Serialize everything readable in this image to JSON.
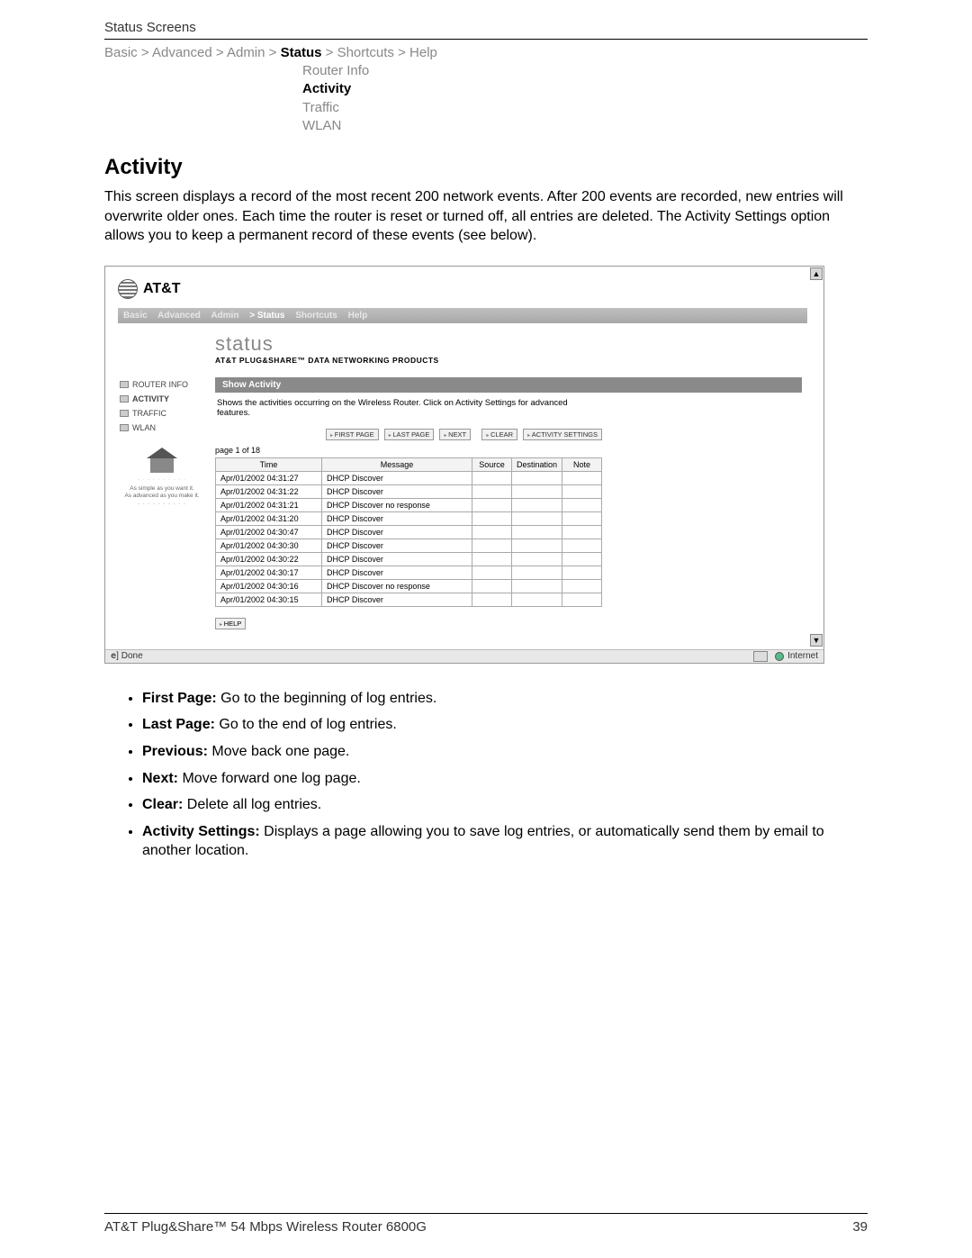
{
  "header": {
    "section": "Status Screens"
  },
  "breadcrumb": {
    "items": [
      "Basic",
      "Advanced",
      "Admin",
      "Status",
      "Shortcuts",
      "Help"
    ],
    "active": "Status"
  },
  "subnav": {
    "items": [
      "Router Info",
      "Activity",
      "Traffic",
      "WLAN"
    ],
    "active": "Activity"
  },
  "title": "Activity",
  "intro": "This screen displays a record of the most recent 200 network events. After 200 events are recorded, new entries will overwrite older ones. Each time the router is reset or turned off, all entries are deleted. The Activity Settings option allows you to keep a permanent record of these events (see below).",
  "screenshot": {
    "logo": "AT&T",
    "tabs": [
      "Basic",
      "Advanced",
      "Admin",
      "Status",
      "Shortcuts",
      "Help"
    ],
    "statusTitle": "status",
    "statusSub": "AT&T PLUG&SHARE™ DATA NETWORKING PRODUCTS",
    "sideItems": [
      "ROUTER INFO",
      "ACTIVITY",
      "TRAFFIC",
      "WLAN"
    ],
    "sideActive": "ACTIVITY",
    "tag1": "As simple as you want it.",
    "tag2": "As advanced as you make it.",
    "panelTitle": "Show Activity",
    "panelDesc": "Shows the activities occurring on the Wireless Router. Click on Activity Settings for advanced features.",
    "buttons": [
      "FIRST PAGE",
      "LAST PAGE",
      "NEXT",
      "CLEAR",
      "ACTIVITY SETTINGS"
    ],
    "pageInfo": "page 1 of 18",
    "cols": [
      "Time",
      "Message",
      "Source",
      "Destination",
      "Note"
    ],
    "rows": [
      {
        "t": "Apr/01/2002 04:31:27",
        "m": "DHCP Discover"
      },
      {
        "t": "Apr/01/2002 04:31:22",
        "m": "DHCP Discover"
      },
      {
        "t": "Apr/01/2002 04:31:21",
        "m": "DHCP Discover no response"
      },
      {
        "t": "Apr/01/2002 04:31:20",
        "m": "DHCP Discover"
      },
      {
        "t": "Apr/01/2002 04:30:47",
        "m": "DHCP Discover"
      },
      {
        "t": "Apr/01/2002 04:30:30",
        "m": "DHCP Discover"
      },
      {
        "t": "Apr/01/2002 04:30:22",
        "m": "DHCP Discover"
      },
      {
        "t": "Apr/01/2002 04:30:17",
        "m": "DHCP Discover"
      },
      {
        "t": "Apr/01/2002 04:30:16",
        "m": "DHCP Discover no response"
      },
      {
        "t": "Apr/01/2002 04:30:15",
        "m": "DHCP Discover"
      }
    ],
    "helpBtn": "HELP",
    "statusDone": "Done",
    "statusNet": "Internet"
  },
  "bullets": [
    {
      "term": "First Page:",
      "desc": " Go to the beginning of log entries."
    },
    {
      "term": "Last Page:",
      "desc": " Go to the end of log entries."
    },
    {
      "term": "Previous:",
      "desc": " Move back one page."
    },
    {
      "term": "Next:",
      "desc": " Move forward one log page."
    },
    {
      "term": "Clear:",
      "desc": " Delete all log entries."
    },
    {
      "term": "Activity Settings:",
      "desc": " Displays a page allowing you to save log entries, or automatically send them by email to another location."
    }
  ],
  "footer": {
    "left": "AT&T Plug&Share™ 54 Mbps Wireless Router 6800G",
    "right": "39"
  }
}
